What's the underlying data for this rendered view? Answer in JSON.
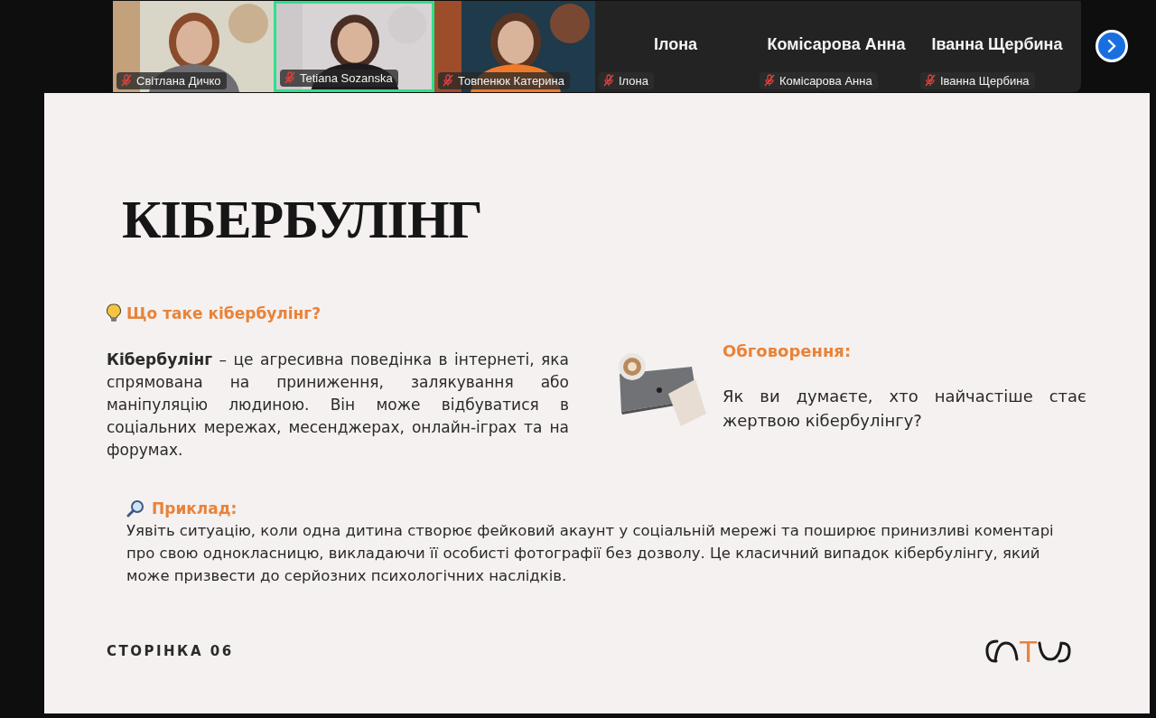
{
  "participants": [
    {
      "kind": "video",
      "name": "Світлана Дичко",
      "muted": true,
      "speaking": false
    },
    {
      "kind": "video",
      "name": "Tetiana Sozanska",
      "muted": true,
      "speaking": true
    },
    {
      "kind": "video",
      "name": "Товпенюк Катерина",
      "muted": true,
      "speaking": false
    },
    {
      "kind": "name",
      "display": "Ілона",
      "name": "Ілона",
      "muted": true,
      "speaking": false
    },
    {
      "kind": "name",
      "display": "Комісарова Анна",
      "name": "Комісарова Анна",
      "muted": true,
      "speaking": false
    },
    {
      "kind": "name",
      "display": "Іванна Щербина",
      "name": "Іванна Щербина",
      "muted": true,
      "speaking": false
    }
  ],
  "slide": {
    "title": "КІБЕРБУЛІНГ",
    "question": "Що таке кібербулінг?",
    "definition": "**Кібербулінг** – це агресивна поведінка в інтернеті, яка спрямована на приниження, залякування або маніпуляцію людиною. Він може відбуватися в соціальних мережах, месенджерах, онлайн-іграх та на форумах.",
    "discussion_heading": "Обговорення:",
    "discussion_text": "Як ви думаєте, хто найчастіше стає жертвою кібербулінгу?",
    "example_heading": "Приклад:",
    "example_text": "Уявіть ситуацію, коли одна дитина створює фейковий акаунт у соціальній мережі та поширює принизливі коментарі про свою однокласницю, викладаючи її особисті фотографії без дозволу. Це класичний випадок кібербулінгу, який може призвести до серйозних психологічних наслідків.",
    "page": "СТОРІНКА 06",
    "logo_letter": "T"
  }
}
